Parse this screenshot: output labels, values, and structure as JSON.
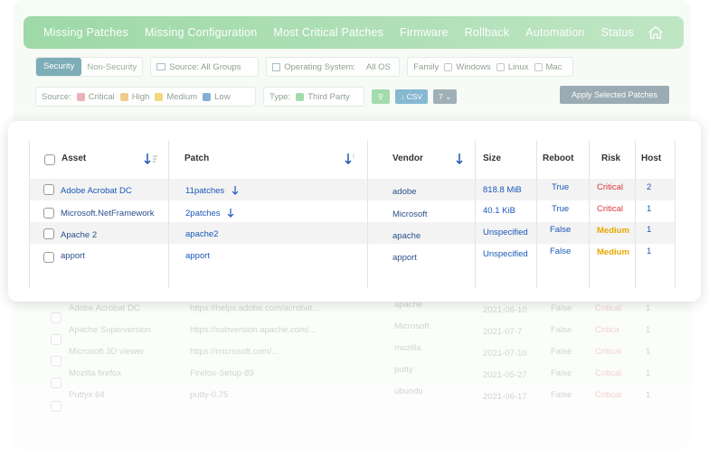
{
  "nav": {
    "items": [
      "Missing Patches",
      "Missing Configuration",
      "Most Critical Patches",
      "Firmware",
      "Rollback",
      "Automation",
      "Status"
    ]
  },
  "filters": {
    "security_label": "Security",
    "non_security_label": "Non-Security",
    "source_groups": "Source:  All Groups",
    "os_label": "Operating System:",
    "os_value": "All OS",
    "family_label": "Family",
    "family_windows": "Windows",
    "family_linux": "Linux",
    "family_mac": "Mac",
    "source_label": "Source:",
    "severity_critical": "Critical",
    "severity_high": "High",
    "severity_medium": "Medium",
    "severity_low": "Low",
    "type_label": "Type:",
    "type_third_party": "Third Party",
    "csv_label": "CSV",
    "page_size": "7",
    "apply_label": "Apply Selected Patches"
  },
  "table": {
    "headers": {
      "asset": "Asset",
      "patch": "Patch",
      "vendor": "Vendor",
      "size": "Size",
      "reboot": "Reboot",
      "risk": "Risk",
      "host": "Host"
    },
    "rows": [
      {
        "asset": "Adobe Acrobat DC",
        "patch": "11patches",
        "vendor": "adobe",
        "size": "818.8 MiB",
        "reboot": "True",
        "risk": "Critical",
        "host": "2"
      },
      {
        "asset": "Microsoft.NetFramework",
        "patch": "2patches",
        "vendor": "Microsoft",
        "size": "40.1 KiB",
        "reboot": "True",
        "risk": "Critical",
        "host": "1"
      },
      {
        "asset": "Apache 2",
        "patch": "apache2",
        "vendor": "apache",
        "size": "Unspecified",
        "reboot": "False",
        "risk": "Medium",
        "host": "1"
      },
      {
        "asset": "apport",
        "patch": "apport",
        "vendor": "apport",
        "size": "Unspecified",
        "reboot": "False",
        "risk": "Medium",
        "host": "1"
      }
    ]
  },
  "faded_rows": [
    {
      "asset": "Adobe Acrobat DC",
      "patch": "https://helpx.adobe.com/acrobat...",
      "vendor": "apache",
      "date": "2021-06-10",
      "reboot": "False",
      "risk": "Critical",
      "host": "1"
    },
    {
      "asset": "Apache Superversion",
      "patch": "https://subversion.apache.com/...",
      "vendor": "Microsoft",
      "date": "2021-07-7",
      "reboot": "False",
      "risk": "Critica",
      "host": "1"
    },
    {
      "asset": "Microsoft 3D viewer",
      "patch": "https://microsoft.com/...",
      "vendor": "mozilla",
      "date": "2021-07-10",
      "reboot": "False",
      "risk": "Critical",
      "host": "1"
    },
    {
      "asset": "Mozilla firefox",
      "patch": "Firefox-Setup-89",
      "vendor": "putty",
      "date": "2021-05-27",
      "reboot": "False",
      "risk": "Critical",
      "host": "1"
    },
    {
      "asset": "Puttyx 64",
      "patch": "putty-0.75",
      "vendor": "ubundu",
      "date": "2021-06-17",
      "reboot": "False",
      "risk": "Critical",
      "host": "1"
    }
  ],
  "colors": {
    "nav_green": "#8fd49a",
    "critical": "#d93b3b",
    "medium": "#e6a800",
    "link_blue": "#1a58b8"
  }
}
